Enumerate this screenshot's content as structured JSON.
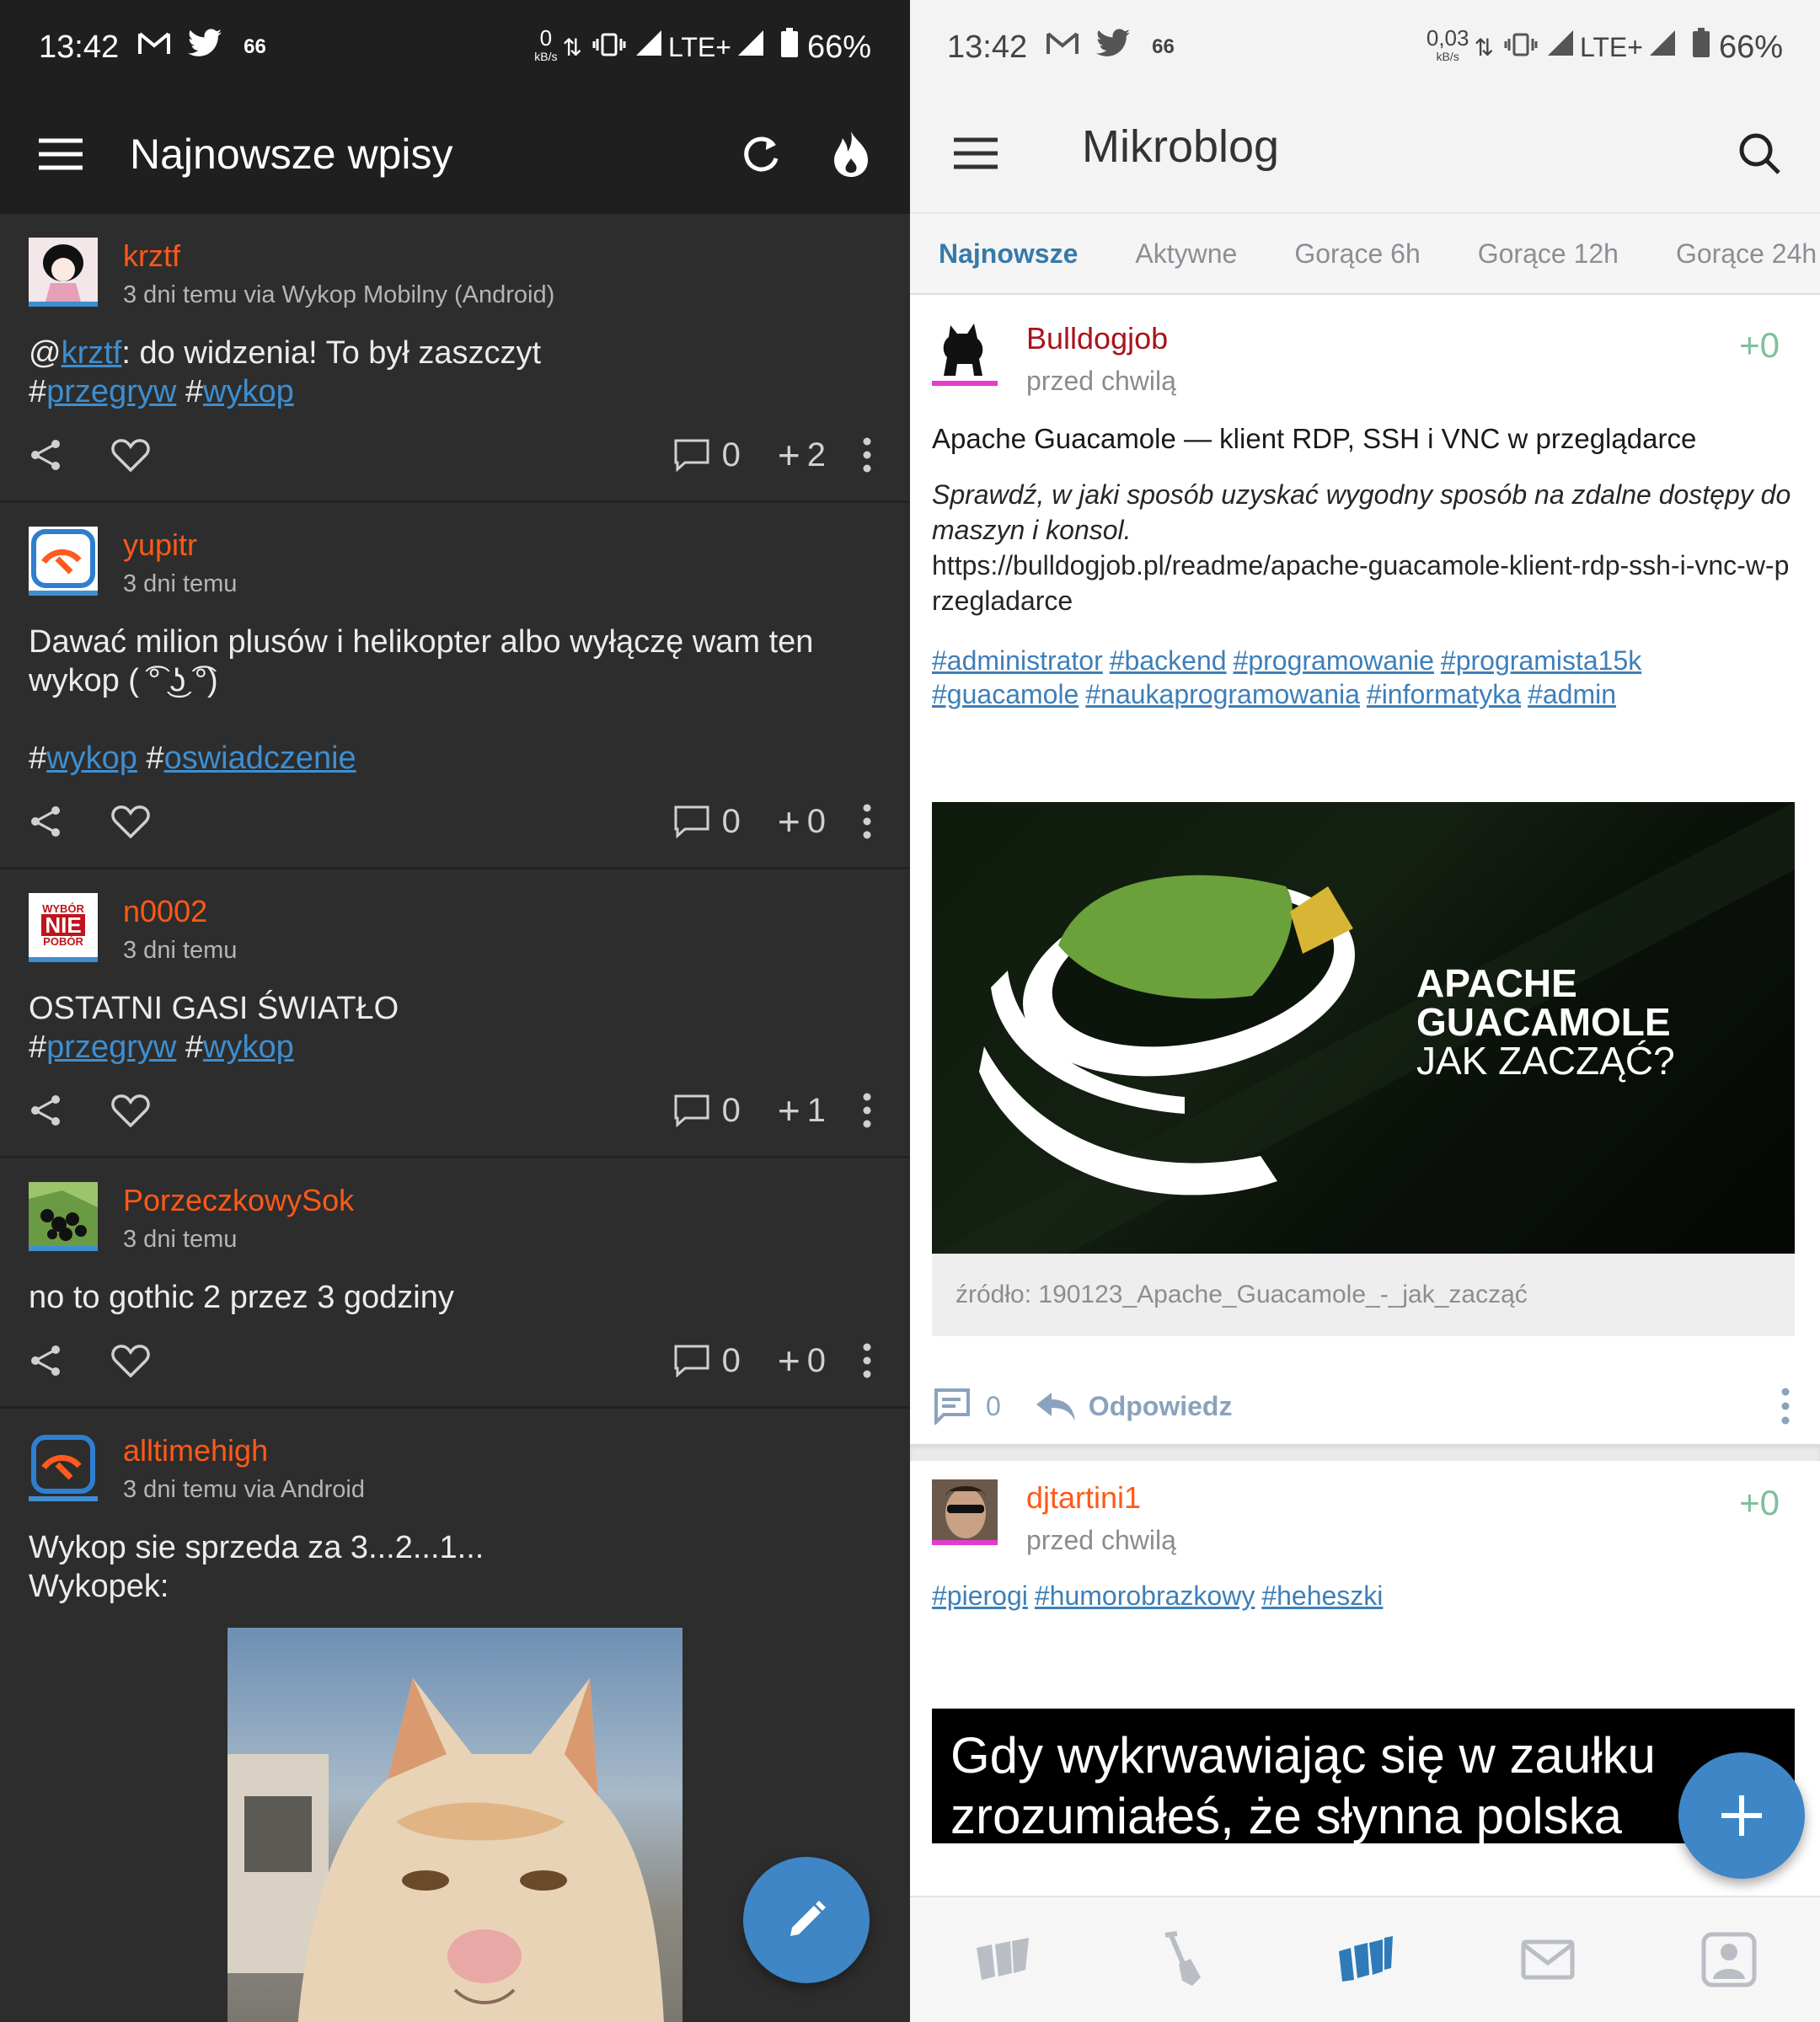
{
  "left": {
    "status": {
      "time": "13:42",
      "notif_count": "66",
      "net_speed": "0",
      "net_unit": "kB/s",
      "network": "LTE+",
      "battery": "66%"
    },
    "appbar": {
      "title": "Najnowsze wpisy"
    },
    "posts": [
      {
        "nick": "krztf",
        "meta": "3 dni temu via Wykop Mobilny (Android)",
        "prefix": "@",
        "mention": "krztf",
        "text": ": do widzenia! To był zaszczyt",
        "tag1": "przegryw",
        "tag2": "wykop",
        "comments": "0",
        "votes": "2"
      },
      {
        "nick": "yupitr",
        "meta": "3 dni temu",
        "text": "Dawać milion plusów i helikopter albo wyłączę wam ten wykop ( ͡° ͜ʖ ͡°)",
        "tag1": "wykop",
        "tag2": "oswiadczenie",
        "comments": "0",
        "votes": "0"
      },
      {
        "nick": "n0002",
        "meta": "3 dni temu",
        "text": "OSTATNI GASI ŚWIATŁO",
        "tag1": "przegryw",
        "tag2": "wykop",
        "comments": "0",
        "votes": "1",
        "avatar_text": {
          "top": "WYBÓR",
          "mid": "NIE",
          "bottom": "POBÓR"
        }
      },
      {
        "nick": "PorzeczkowySok",
        "meta": "3 dni temu",
        "text": "no to gothic 2 przez 3 godziny",
        "comments": "0",
        "votes": "0"
      },
      {
        "nick": "alltimehigh",
        "meta": "3 dni temu via Android",
        "line1": "Wykop sie sprzeda za 3...2...1...",
        "line2": "Wykopek:"
      }
    ],
    "hash": "#",
    "plus": "+"
  },
  "right": {
    "status": {
      "time": "13:42",
      "notif_count": "66",
      "net_speed": "0,03",
      "net_unit": "kB/s",
      "network": "LTE+",
      "battery": "66%"
    },
    "appbar": {
      "title": "Mikroblog"
    },
    "tabs": [
      "Najnowsze",
      "Aktywne",
      "Gorące 6h",
      "Gorące 12h",
      "Gorące 24h"
    ],
    "post1": {
      "nick": "Bulldogjob",
      "time": "przed chwilą",
      "vote": "+0",
      "title": "Apache Guacamole — klient RDP, SSH i VNC w przeglądarce",
      "italic": "Sprawdź, w jaki sposób uzyskać wygodny sposób na zdalne dostępy do maszyn i konsol.",
      "url": "https://bulldogjob.pl/readme/apache-guacamole-klient-rdp-ssh-i-vnc-w-przegladarce",
      "tags": [
        "#administrator",
        "#backend",
        "#programowanie",
        "#programista15k",
        "#guacamole",
        "#naukaprogramowania",
        "#informatyka",
        "#admin"
      ],
      "image_text": [
        "APACHE",
        "GUACAMOLE",
        "JAK ZACZĄĆ?"
      ],
      "caption": "źródło: 190123_Apache_Guacamole_-_jak_zacząć",
      "comments": "0",
      "reply": "Odpowiedz"
    },
    "post2": {
      "nick": "djtartini1",
      "time": "przed chwilą",
      "vote": "+0",
      "tags": [
        "#pierogi",
        "#humorobrazkowy",
        "#heheszki"
      ],
      "image_line1": "Gdy wykrwawiając się w zaułku",
      "image_line2": "zrozumiałeś, że słynna polska"
    }
  },
  "colors": {
    "left_bg": "#2d2d2d",
    "left_bar": "#1f1f1f",
    "nick_orange": "#ff5917",
    "link_blue": "#3e8ed0",
    "fab_blue": "#3e86c6",
    "bulldog_red": "#a8131c",
    "tab_active": "#367aa9",
    "vote_green": "#7fbf9a"
  }
}
